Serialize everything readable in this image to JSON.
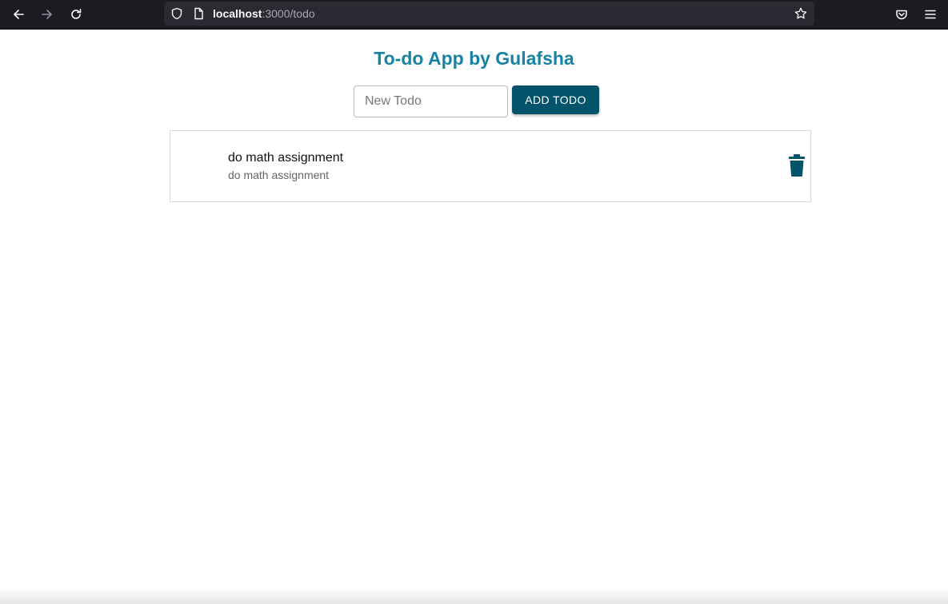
{
  "browser": {
    "url_host": "localhost",
    "url_path": ":3000/todo",
    "icons": [
      "back-arrow-icon",
      "forward-arrow-icon",
      "reload-icon",
      "shield-icon",
      "page-icon",
      "bookmark-star-icon",
      "pocket-icon",
      "menu-icon"
    ]
  },
  "app": {
    "title": "To-do App by Gulafsha",
    "input_placeholder": "New Todo",
    "input_value": "",
    "add_button_label": "ADD TODO",
    "todos": [
      {
        "primary": "do math assignment",
        "secondary": "do math assignment"
      }
    ]
  },
  "colors": {
    "title": "#1583a4",
    "accent": "#03546a",
    "chrome_bg": "#1c1b22",
    "urlbar_bg": "#2b2a33"
  }
}
